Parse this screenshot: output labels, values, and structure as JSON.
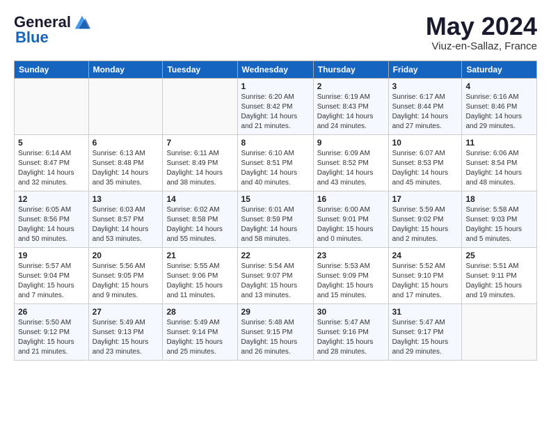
{
  "header": {
    "logo_general": "General",
    "logo_blue": "Blue",
    "month_title": "May 2024",
    "location": "Viuz-en-Sallaz, France"
  },
  "days_of_week": [
    "Sunday",
    "Monday",
    "Tuesday",
    "Wednesday",
    "Thursday",
    "Friday",
    "Saturday"
  ],
  "weeks": [
    [
      {
        "day": "",
        "content": ""
      },
      {
        "day": "",
        "content": ""
      },
      {
        "day": "",
        "content": ""
      },
      {
        "day": "1",
        "content": "Sunrise: 6:20 AM\nSunset: 8:42 PM\nDaylight: 14 hours\nand 21 minutes."
      },
      {
        "day": "2",
        "content": "Sunrise: 6:19 AM\nSunset: 8:43 PM\nDaylight: 14 hours\nand 24 minutes."
      },
      {
        "day": "3",
        "content": "Sunrise: 6:17 AM\nSunset: 8:44 PM\nDaylight: 14 hours\nand 27 minutes."
      },
      {
        "day": "4",
        "content": "Sunrise: 6:16 AM\nSunset: 8:46 PM\nDaylight: 14 hours\nand 29 minutes."
      }
    ],
    [
      {
        "day": "5",
        "content": "Sunrise: 6:14 AM\nSunset: 8:47 PM\nDaylight: 14 hours\nand 32 minutes."
      },
      {
        "day": "6",
        "content": "Sunrise: 6:13 AM\nSunset: 8:48 PM\nDaylight: 14 hours\nand 35 minutes."
      },
      {
        "day": "7",
        "content": "Sunrise: 6:11 AM\nSunset: 8:49 PM\nDaylight: 14 hours\nand 38 minutes."
      },
      {
        "day": "8",
        "content": "Sunrise: 6:10 AM\nSunset: 8:51 PM\nDaylight: 14 hours\nand 40 minutes."
      },
      {
        "day": "9",
        "content": "Sunrise: 6:09 AM\nSunset: 8:52 PM\nDaylight: 14 hours\nand 43 minutes."
      },
      {
        "day": "10",
        "content": "Sunrise: 6:07 AM\nSunset: 8:53 PM\nDaylight: 14 hours\nand 45 minutes."
      },
      {
        "day": "11",
        "content": "Sunrise: 6:06 AM\nSunset: 8:54 PM\nDaylight: 14 hours\nand 48 minutes."
      }
    ],
    [
      {
        "day": "12",
        "content": "Sunrise: 6:05 AM\nSunset: 8:56 PM\nDaylight: 14 hours\nand 50 minutes."
      },
      {
        "day": "13",
        "content": "Sunrise: 6:03 AM\nSunset: 8:57 PM\nDaylight: 14 hours\nand 53 minutes."
      },
      {
        "day": "14",
        "content": "Sunrise: 6:02 AM\nSunset: 8:58 PM\nDaylight: 14 hours\nand 55 minutes."
      },
      {
        "day": "15",
        "content": "Sunrise: 6:01 AM\nSunset: 8:59 PM\nDaylight: 14 hours\nand 58 minutes."
      },
      {
        "day": "16",
        "content": "Sunrise: 6:00 AM\nSunset: 9:01 PM\nDaylight: 15 hours\nand 0 minutes."
      },
      {
        "day": "17",
        "content": "Sunrise: 5:59 AM\nSunset: 9:02 PM\nDaylight: 15 hours\nand 2 minutes."
      },
      {
        "day": "18",
        "content": "Sunrise: 5:58 AM\nSunset: 9:03 PM\nDaylight: 15 hours\nand 5 minutes."
      }
    ],
    [
      {
        "day": "19",
        "content": "Sunrise: 5:57 AM\nSunset: 9:04 PM\nDaylight: 15 hours\nand 7 minutes."
      },
      {
        "day": "20",
        "content": "Sunrise: 5:56 AM\nSunset: 9:05 PM\nDaylight: 15 hours\nand 9 minutes."
      },
      {
        "day": "21",
        "content": "Sunrise: 5:55 AM\nSunset: 9:06 PM\nDaylight: 15 hours\nand 11 minutes."
      },
      {
        "day": "22",
        "content": "Sunrise: 5:54 AM\nSunset: 9:07 PM\nDaylight: 15 hours\nand 13 minutes."
      },
      {
        "day": "23",
        "content": "Sunrise: 5:53 AM\nSunset: 9:09 PM\nDaylight: 15 hours\nand 15 minutes."
      },
      {
        "day": "24",
        "content": "Sunrise: 5:52 AM\nSunset: 9:10 PM\nDaylight: 15 hours\nand 17 minutes."
      },
      {
        "day": "25",
        "content": "Sunrise: 5:51 AM\nSunset: 9:11 PM\nDaylight: 15 hours\nand 19 minutes."
      }
    ],
    [
      {
        "day": "26",
        "content": "Sunrise: 5:50 AM\nSunset: 9:12 PM\nDaylight: 15 hours\nand 21 minutes."
      },
      {
        "day": "27",
        "content": "Sunrise: 5:49 AM\nSunset: 9:13 PM\nDaylight: 15 hours\nand 23 minutes."
      },
      {
        "day": "28",
        "content": "Sunrise: 5:49 AM\nSunset: 9:14 PM\nDaylight: 15 hours\nand 25 minutes."
      },
      {
        "day": "29",
        "content": "Sunrise: 5:48 AM\nSunset: 9:15 PM\nDaylight: 15 hours\nand 26 minutes."
      },
      {
        "day": "30",
        "content": "Sunrise: 5:47 AM\nSunset: 9:16 PM\nDaylight: 15 hours\nand 28 minutes."
      },
      {
        "day": "31",
        "content": "Sunrise: 5:47 AM\nSunset: 9:17 PM\nDaylight: 15 hours\nand 29 minutes."
      },
      {
        "day": "",
        "content": ""
      }
    ]
  ]
}
